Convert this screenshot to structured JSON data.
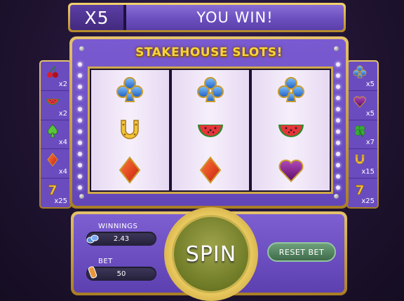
{
  "banner": {
    "multiplier": "X5",
    "message": "YOU WIN!"
  },
  "machine": {
    "title": "STAKEHOUSE SLOTS!"
  },
  "reels": [
    [
      "club",
      "horseshoe",
      "diamond"
    ],
    [
      "club",
      "watermelon",
      "diamond"
    ],
    [
      "club",
      "watermelon",
      "heart"
    ]
  ],
  "paytable_left": [
    {
      "icon": "cherry",
      "mult": "x2"
    },
    {
      "icon": "watermelon",
      "mult": "x2"
    },
    {
      "icon": "spade",
      "mult": "x4"
    },
    {
      "icon": "diamond",
      "mult": "x4"
    },
    {
      "icon": "seven",
      "mult": "x25"
    }
  ],
  "paytable_right": [
    {
      "icon": "club",
      "mult": "x5"
    },
    {
      "icon": "heart",
      "mult": "x5"
    },
    {
      "icon": "clover",
      "mult": "x7"
    },
    {
      "icon": "horseshoe",
      "mult": "x15"
    },
    {
      "icon": "seven",
      "mult": "x25"
    }
  ],
  "controls": {
    "winnings_label": "WINNINGS",
    "winnings_value": "2.43",
    "bet_label": "BET",
    "bet_value": "50",
    "spin_label": "SPIN",
    "reset_label": "RESET BET"
  },
  "colors": {
    "accent_gold": "#e4c26a",
    "panel_purple": "#6a4cbf",
    "title_yellow": "#f7d438"
  }
}
